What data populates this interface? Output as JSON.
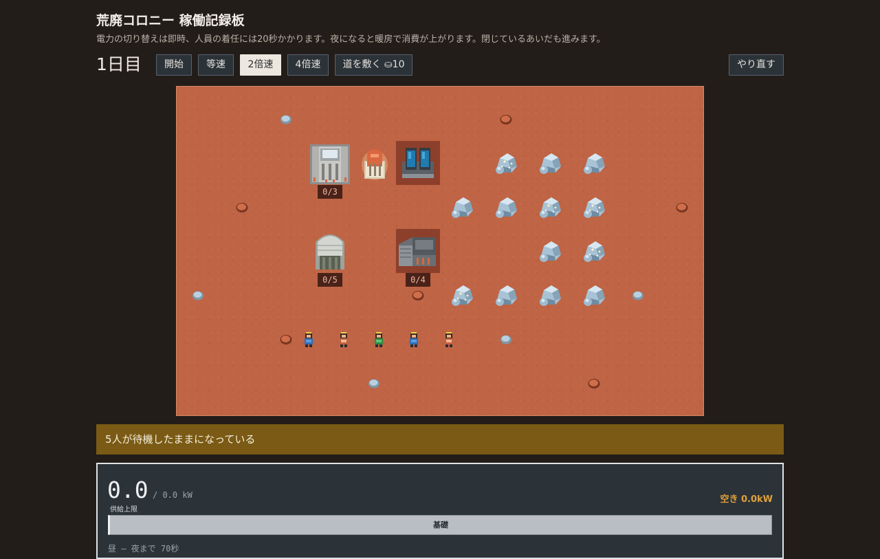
{
  "header": {
    "title": "荒廃コロニー 稼働記録板",
    "description": "電力の切り替えは即時、人員の着任には20秒かかります。夜になると暖房で消費が上がります。閉じているあいだも進みます。"
  },
  "toolbar": {
    "day_label": "1日目",
    "start_label": "開始",
    "speed_1x_label": "等速",
    "speed_2x_label": "2倍速",
    "speed_4x_label": "4倍速",
    "road_label": "道を敷く ⛀10",
    "reset_label": "やり直す",
    "active_speed": "2x"
  },
  "map": {
    "buildings": [
      {
        "name": "habitat-module",
        "capacity": "0/3"
      },
      {
        "name": "storage-silo",
        "capacity": "0/5"
      },
      {
        "name": "factory",
        "capacity": "0/4"
      }
    ]
  },
  "alert": {
    "message": "5人が待機したままになっている"
  },
  "power": {
    "supply": "0.0",
    "capacity_text": "/ 0.0 kW",
    "supply_label": "供給上限",
    "free_text": "空き 0.0kW",
    "bar_label": "基礎",
    "day_night_text": "昼 — 夜まで 70秒"
  },
  "colors": {
    "ground": "#bf6444",
    "alert_bg": "#7a5a14",
    "accent": "#e0a03a"
  }
}
